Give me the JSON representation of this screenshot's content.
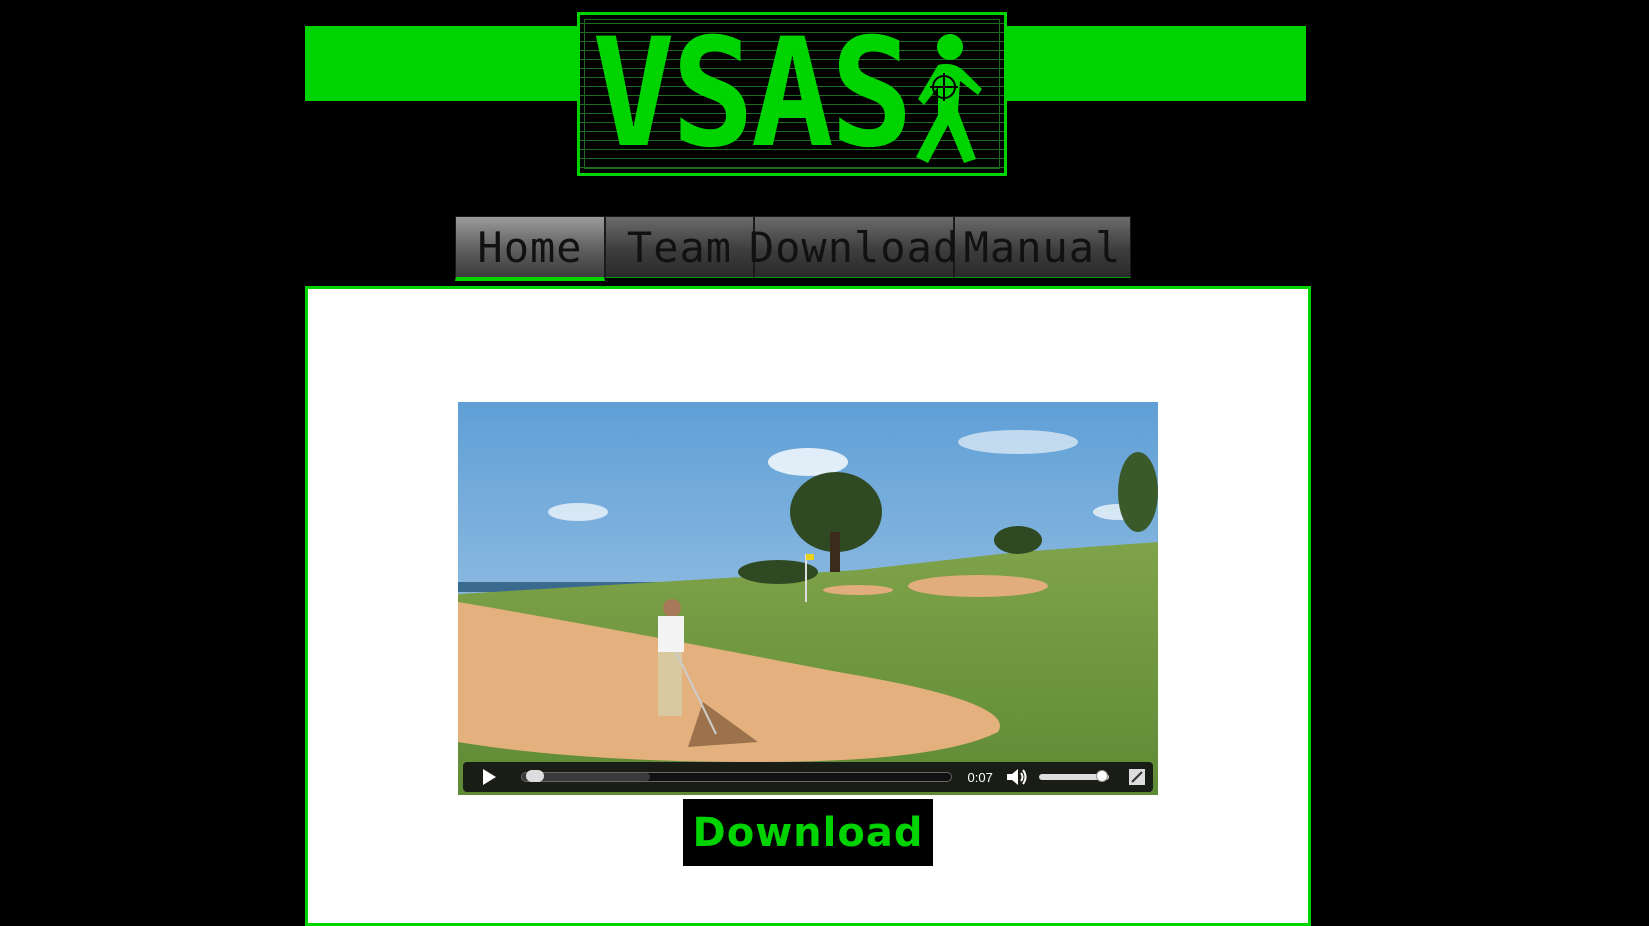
{
  "logo": {
    "text": "VSAS",
    "icon": "walking-person-crosshair-icon"
  },
  "nav": {
    "items": [
      {
        "label": "Home",
        "active": true
      },
      {
        "label": "Team",
        "active": false
      },
      {
        "label": "Download",
        "active": false
      },
      {
        "label": "Manual",
        "active": false
      }
    ]
  },
  "video": {
    "time": "0:07",
    "progress_fraction": 0.02,
    "buffered_fraction": 0.3,
    "volume_fraction": 0.9,
    "icons": {
      "play": "play-icon",
      "mute": "speaker-icon",
      "fullscreen": "fullscreen-icon"
    }
  },
  "download_button": {
    "label": "Download"
  },
  "colors": {
    "accent": "#00d400",
    "background": "#000000",
    "content": "#ffffff"
  }
}
